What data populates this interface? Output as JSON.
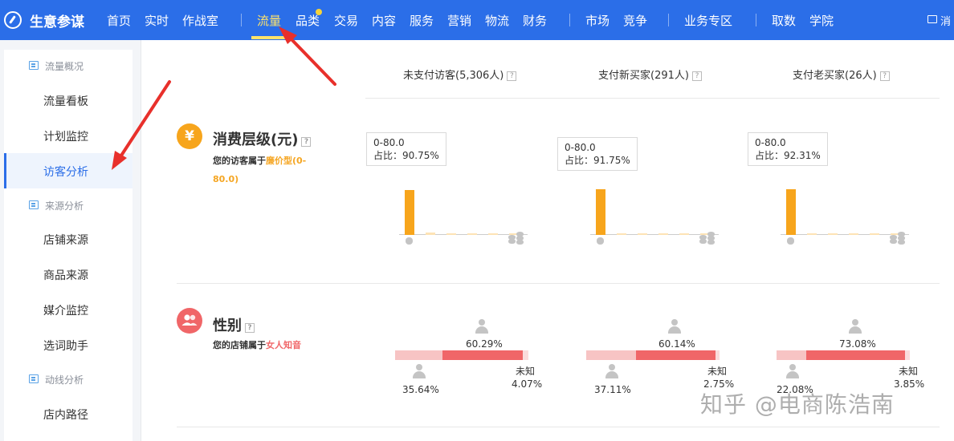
{
  "app": {
    "brand": "生意参谋"
  },
  "nav": {
    "items": [
      "首页",
      "实时",
      "作战室",
      "流量",
      "品类",
      "交易",
      "内容",
      "服务",
      "营销",
      "物流",
      "财务",
      "市场",
      "竞争",
      "业务专区",
      "取数",
      "学院"
    ],
    "active": "流量",
    "message_label": "消"
  },
  "sidebar": {
    "groups": [
      {
        "label": "流量概况",
        "items": [
          "流量看板",
          "计划监控",
          "访客分析"
        ]
      },
      {
        "label": "来源分析",
        "items": [
          "店铺来源",
          "商品来源",
          "媒介监控",
          "选词助手"
        ]
      },
      {
        "label": "动线分析",
        "items": [
          "店内路径"
        ]
      }
    ],
    "active": "访客分析"
  },
  "columns": {
    "headers": [
      "未支付访客(5,306人)",
      "支付新买家(291人)",
      "支付老买家(26人)"
    ],
    "help": "?"
  },
  "consumption": {
    "icon_glyph": "¥",
    "title": "消费层级(元)",
    "desc_prefix": "您的访客属于",
    "desc_highlight": "廉价型(0-80.0)",
    "charts": [
      {
        "tooltip_range": "0-80.0",
        "tooltip_ratio": "占比：90.75%",
        "values": [
          90.75,
          4.5,
          2.0,
          1.2,
          0.8,
          0.5
        ]
      },
      {
        "tooltip_range": "0-80.0",
        "tooltip_ratio": "占比：91.75%",
        "values": [
          91.75,
          4.0,
          2.0,
          1.0,
          0.7,
          0.5
        ]
      },
      {
        "tooltip_range": "0-80.0",
        "tooltip_ratio": "占比：92.31%",
        "values": [
          92.31,
          3.5,
          2.5,
          1.0,
          0.4,
          0.3
        ]
      }
    ]
  },
  "gender": {
    "title": "性别",
    "desc_prefix": "您的店铺属于",
    "desc_highlight": "女人知音",
    "unknown_label": "未知",
    "charts": [
      {
        "male": 35.64,
        "female": 60.29,
        "unknown": 4.07,
        "male_label": "35.64%",
        "female_label": "60.29%",
        "unknown_label": "4.07%"
      },
      {
        "male": 37.11,
        "female": 60.14,
        "unknown": 2.75,
        "male_label": "37.11%",
        "female_label": "60.14%",
        "unknown_label": "2.75%"
      },
      {
        "male": 22.08,
        "female": 73.08,
        "unknown": 3.85,
        "male_label": "22.08%",
        "female_label": "73.08%",
        "unknown_label": "3.85%"
      }
    ]
  },
  "colors": {
    "nav_bg": "#2b6ee8",
    "nav_active": "#ffe36b",
    "bar": "#f7a51c",
    "bar_light": "#fde3b5",
    "female": "#f06668",
    "male": "#f7c4c4",
    "annotation_arrow": "#e8302b"
  },
  "watermark": "知乎 @电商陈浩南"
}
